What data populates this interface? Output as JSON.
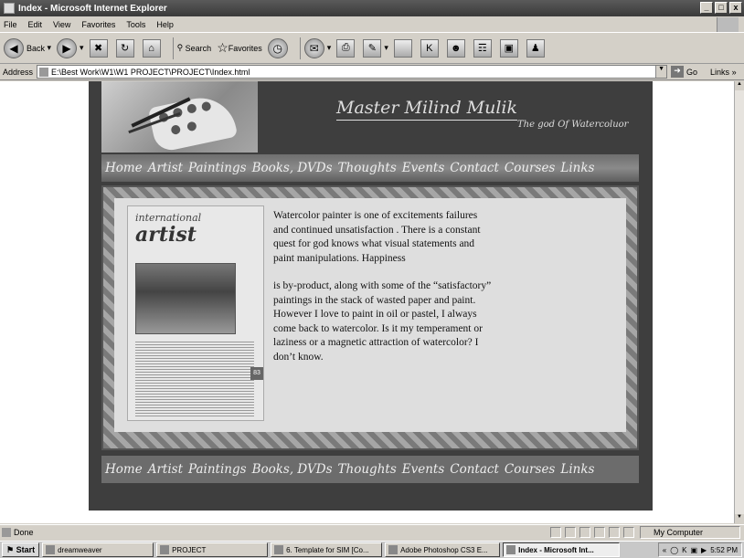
{
  "window": {
    "title": "Index - Microsoft Internet Explorer",
    "controls": [
      "_",
      "□",
      "x"
    ]
  },
  "menu": [
    "File",
    "Edit",
    "View",
    "Favorites",
    "Tools",
    "Help"
  ],
  "toolbar": {
    "back": "Back",
    "search": "Search",
    "favorites": "Favorites"
  },
  "address": {
    "label": "Address",
    "value": "E:\\Best Work\\W1\\W1 PROJECT\\PROJECT\\Index.html",
    "go": "Go",
    "links": "Links"
  },
  "site": {
    "title": "Master Milind Mulik",
    "tagline": "The god Of Watercoluor",
    "nav": [
      "Home",
      "Artist",
      "Paintings",
      "Books, DVDs",
      "Thoughts",
      "Events",
      "Contact",
      "Courses",
      "Links"
    ],
    "magazine": {
      "line1": "international",
      "line2": "artist",
      "page": "83"
    },
    "body": [
      "Watercolor painter is one of excitements failures and continued unsatisfaction . There is a constant quest for god knows what visual statements and paint manipulations. Happiness",
      "is by-product, along with some of the “satisfactory” paintings in the stack of wasted paper and paint. However I love to paint in oil or pastel, I always come back to watercolor. Is it my temperament or laziness or a magnetic attraction of watercolor? I don’t know."
    ]
  },
  "status": {
    "text": "Done",
    "zone": "My Computer"
  },
  "taskbar": {
    "start": "Start",
    "tasks": [
      "dreamweaver",
      "PROJECT",
      "6. Template for SIM [Co...",
      "Adobe Photoshop CS3 E...",
      "Index - Microsoft Int..."
    ],
    "clock": "5:52 PM"
  }
}
